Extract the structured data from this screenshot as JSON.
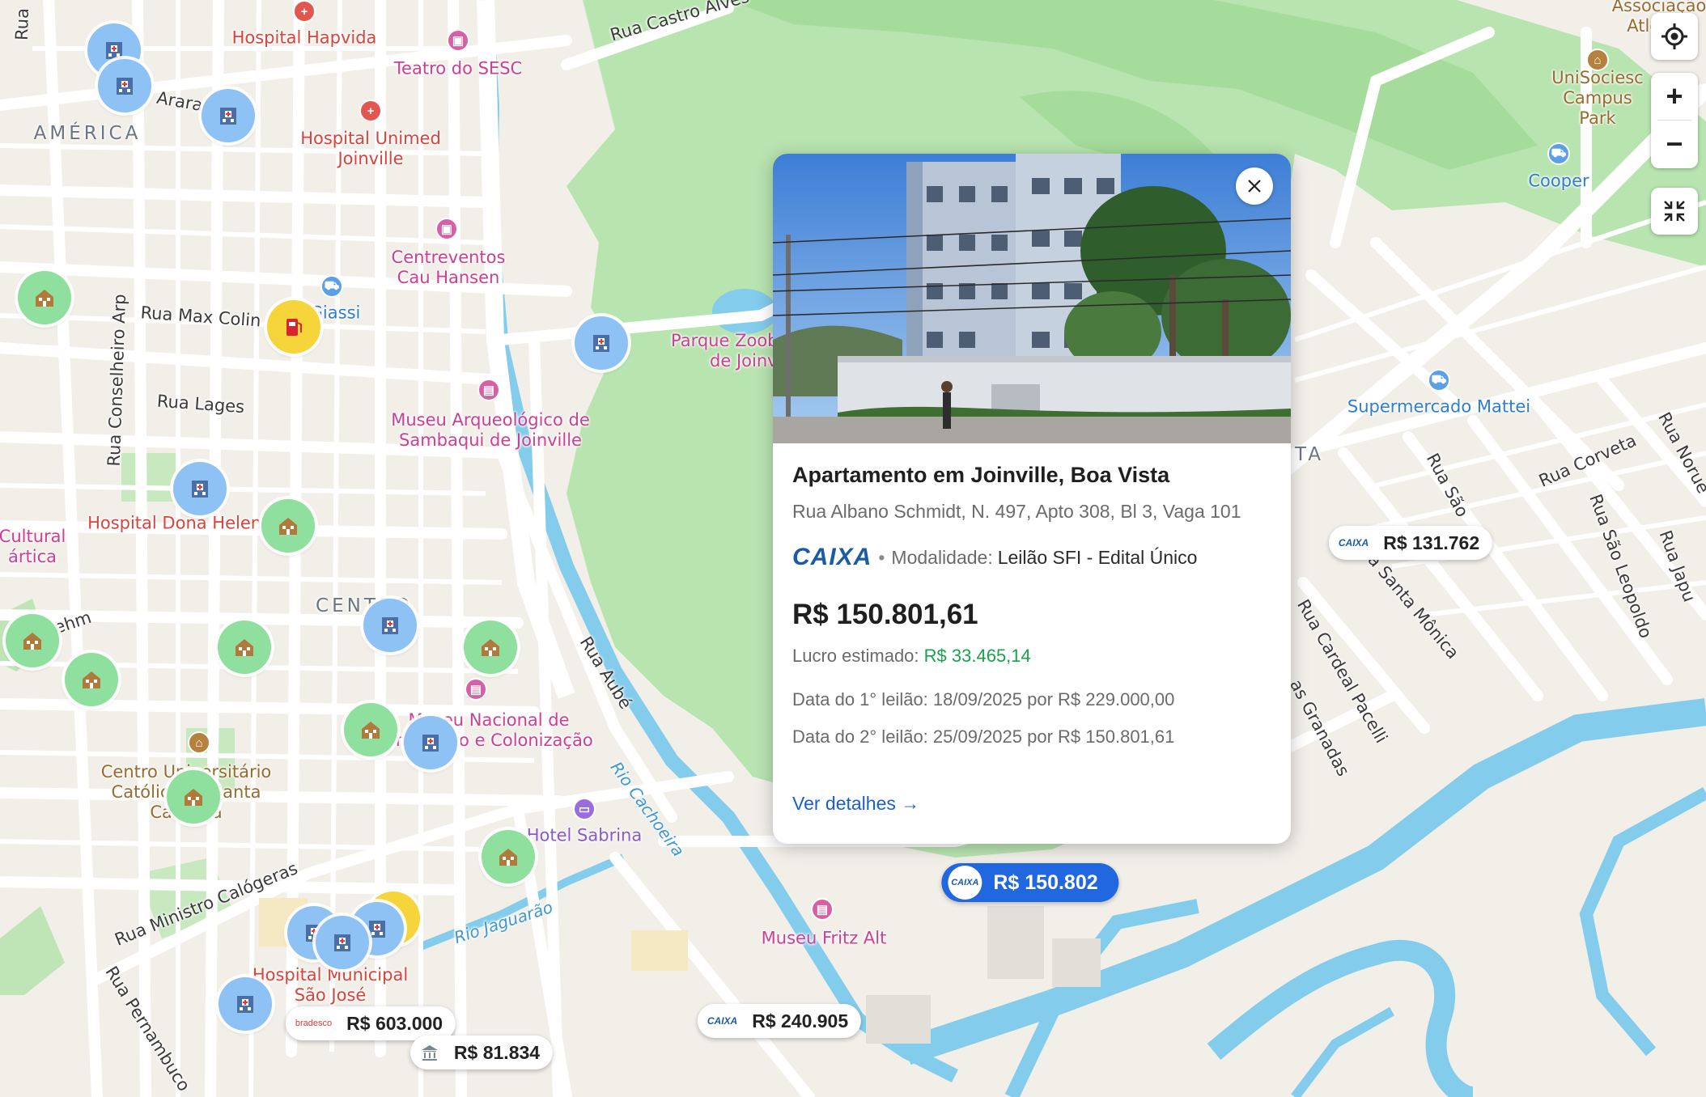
{
  "map": {
    "districts": [
      "AMÉRICA",
      "CENTRO",
      "TA"
    ],
    "streets": [
      "Rua Max Colin",
      "Rua Lages",
      "Rua Conselheiro Arp",
      "Rua Ministro Calógeras",
      "Rua Pernambuco",
      "Rua Aubé",
      "Rua Castro Alves",
      "Arara",
      "Rua Cardeal Pacelli",
      "Rua São Leopoldo",
      "Rua Corveta",
      "Rua Norue",
      "Rua Japu",
      "Rua São",
      "a Santa Mônica",
      "as Granadas",
      "Rua",
      "ehm"
    ],
    "water": [
      "Rio Cachoeira",
      "Rio Jaguarão"
    ],
    "pois": [
      {
        "name": "Hospital Hapvida",
        "type": "hospital"
      },
      {
        "name": "Teatro do SESC",
        "type": "culture"
      },
      {
        "name": "Hospital Unimed\nJoinville",
        "type": "hospital"
      },
      {
        "name": "Centreventos\nCau Hansen",
        "type": "culture"
      },
      {
        "name": "Giassi",
        "type": "shop"
      },
      {
        "name": "Museu Arqueológico de\nSambaqui de Joinville",
        "type": "culture"
      },
      {
        "name": "Hospital Dona Helena",
        "type": "hospital"
      },
      {
        "name": "Museu Nacional de\nImigração e Colonização",
        "type": "culture"
      },
      {
        "name": "Centro Universitário\nCatólica de Santa\nCatarina",
        "type": "school"
      },
      {
        "name": "Hotel Sabrina",
        "type": "hotel"
      },
      {
        "name": "Hospital Municipal\nSão José",
        "type": "hospital"
      },
      {
        "name": "Museu Fritz Alt",
        "type": "culture"
      },
      {
        "name": "Parque Zoobotânico\nde Joinville",
        "type": "park"
      },
      {
        "name": "Supermercado Mattei",
        "type": "shop"
      },
      {
        "name": "UniSociesc\nCampus Park",
        "type": "school"
      },
      {
        "name": "Cooper",
        "type": "shop"
      },
      {
        "name": "Associação\nAtlética",
        "type": "school"
      },
      {
        "name": "Cultural\nártica",
        "type": "culture"
      }
    ],
    "price_pills": [
      {
        "bank": "CAIXA",
        "price": "R$ 131.762"
      },
      {
        "bank": "bradesco",
        "price": "R$ 603.000"
      },
      {
        "bank": "bank-icon",
        "price": "R$ 81.834"
      },
      {
        "bank": "CAIXA",
        "price": "R$ 240.905"
      },
      {
        "bank": "CAIXA",
        "price": "R$ 150.802",
        "active": true
      }
    ]
  },
  "controls": {
    "locate_icon": "locate-icon",
    "zoom_in_label": "+",
    "zoom_out_label": "−",
    "collapse_icon": "collapse-icon"
  },
  "popup": {
    "title": "Apartamento em Joinville, Boa Vista",
    "address": "Rua Albano Schmidt, N. 497, Apto 308, Bl 3, Vaga 101",
    "bank_logo": "CAIXA",
    "modalidade_label": "Modalidade:",
    "modalidade_value": "Leilão SFI - Edital Único",
    "price": "R$ 150.801,61",
    "profit_label": "Lucro estimado:",
    "profit_value": "R$ 33.465,14",
    "first_auction": "Data do 1° leilão: 18/09/2025 por R$ 229.000,00",
    "second_auction": "Data do 2° leilão: 25/09/2025 por R$ 150.801,61",
    "details_link": "Ver detalhes →"
  },
  "colors": {
    "park_green": "#b9e2b3",
    "forest_green": "#a8dda0",
    "water": "#7fc8ec",
    "accent_blue": "#2167e0",
    "profit_green": "#18a34a",
    "caixa_blue": "#1b5aa6"
  }
}
